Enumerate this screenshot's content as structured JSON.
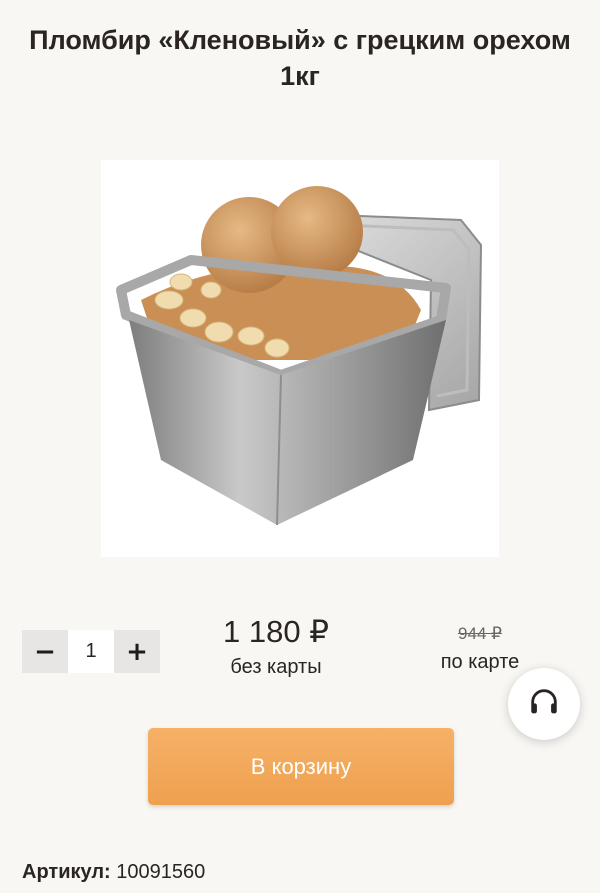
{
  "product": {
    "title_line1": "Пломбир «Кленовый» с грецким орехом",
    "title_line2": "1кг",
    "image_alt": "Ice cream container"
  },
  "quantity": {
    "minus_label": "−",
    "value": "1",
    "plus_label": "+"
  },
  "price": {
    "regular": "1 180 ₽",
    "regular_caption": "без карты",
    "card": "944 ₽",
    "card_caption": "по карте"
  },
  "actions": {
    "add_to_cart": "В корзину"
  },
  "article": {
    "label": "Артикул:",
    "value": "10091560"
  },
  "icons": {
    "support": "headphones-icon"
  },
  "colors": {
    "accent": "#f0a654",
    "background": "#f8f7f3"
  }
}
